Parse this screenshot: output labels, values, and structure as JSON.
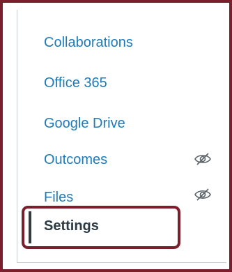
{
  "nav": {
    "items": [
      {
        "label": "Collaborations",
        "hidden_icon": false
      },
      {
        "label": "Office 365",
        "hidden_icon": false
      },
      {
        "label": "Google Drive",
        "hidden_icon": false
      },
      {
        "label": "Outcomes",
        "hidden_icon": true,
        "icon": "eye-slash-icon"
      },
      {
        "label": "Files",
        "hidden_icon": true,
        "icon": "eye-slash-icon"
      }
    ],
    "active": {
      "label": "Settings"
    }
  },
  "colors": {
    "link": "#1f7ab8",
    "active_text": "#2d3b45",
    "highlight": "#7a1f2b",
    "icon": "#5a6268"
  }
}
